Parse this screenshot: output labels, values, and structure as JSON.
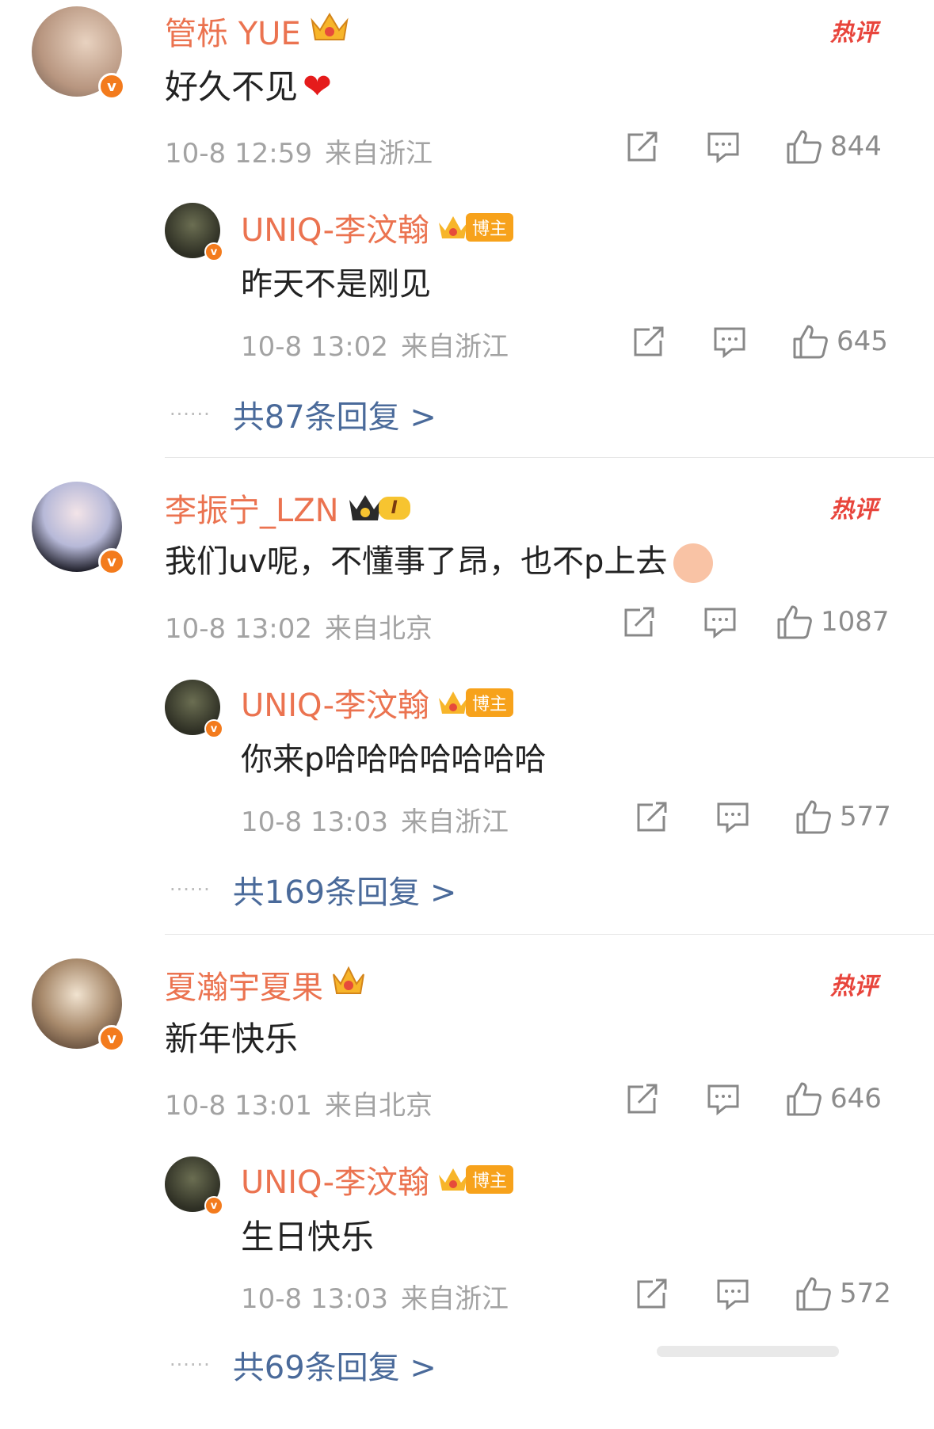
{
  "comments": [
    {
      "author": "管栎 YUE",
      "text": "好久不见",
      "time": "10-8 12:59",
      "location": "来自浙江",
      "likes": "844",
      "hot_label": "热评",
      "emoji": "heart",
      "reply": {
        "author": "UNIQ-李汶翰",
        "badge": "博主",
        "text": "昨天不是刚见",
        "time": "10-8 13:02",
        "location": "来自浙江",
        "likes": "645"
      },
      "more": "共87条回复 >"
    },
    {
      "author": "李振宁_LZN",
      "level": "I",
      "text": "我们uv呢，不懂事了昂，也不p上去",
      "time": "10-8 13:02",
      "location": "来自北京",
      "likes": "1087",
      "hot_label": "热评",
      "emoji": "fan-face",
      "reply": {
        "author": "UNIQ-李汶翰",
        "badge": "博主",
        "text": "你来p哈哈哈哈哈哈哈",
        "time": "10-8 13:03",
        "location": "来自浙江",
        "likes": "577"
      },
      "more": "共169条回复 >"
    },
    {
      "author": "夏瀚宇夏果",
      "text": "新年快乐",
      "time": "10-8 13:01",
      "location": "来自北京",
      "likes": "646",
      "hot_label": "热评",
      "reply": {
        "author": "UNIQ-李汶翰",
        "badge": "博主",
        "text": "生日快乐",
        "time": "10-8 13:03",
        "location": "来自浙江",
        "likes": "572"
      },
      "more": "共69条回复 >"
    }
  ],
  "colors": {
    "name": "#eb7350",
    "hot": "#e8453c",
    "link": "#4a6a9a",
    "meta": "#a3a3a3"
  }
}
